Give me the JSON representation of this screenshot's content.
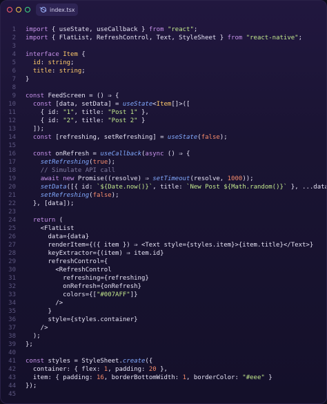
{
  "tab": {
    "label": "index.tsx"
  },
  "lines": [
    {
      "n": "1",
      "tokens": [
        [
          "kw",
          "import"
        ],
        [
          "plain",
          " { useState, useCallback } "
        ],
        [
          "kw",
          "from"
        ],
        [
          "plain",
          " "
        ],
        [
          "str",
          "\"react\""
        ],
        [
          "plain",
          ";"
        ]
      ]
    },
    {
      "n": "2",
      "tokens": [
        [
          "kw",
          "import"
        ],
        [
          "plain",
          " { FlatList, RefreshControl, Text, StyleSheet } "
        ],
        [
          "kw",
          "from"
        ],
        [
          "plain",
          " "
        ],
        [
          "str",
          "\"react-native\""
        ],
        [
          "plain",
          ";"
        ]
      ]
    },
    {
      "n": "3",
      "tokens": []
    },
    {
      "n": "4",
      "tokens": [
        [
          "kw",
          "interface"
        ],
        [
          "plain",
          " "
        ],
        [
          "type",
          "Item"
        ],
        [
          "plain",
          " {"
        ]
      ]
    },
    {
      "n": "5",
      "tokens": [
        [
          "plain",
          "  "
        ],
        [
          "prop",
          "id"
        ],
        [
          "plain",
          ": "
        ],
        [
          "type",
          "string"
        ],
        [
          "plain",
          ";"
        ]
      ]
    },
    {
      "n": "6",
      "tokens": [
        [
          "plain",
          "  "
        ],
        [
          "prop",
          "title"
        ],
        [
          "plain",
          ": "
        ],
        [
          "type",
          "string"
        ],
        [
          "plain",
          ";"
        ]
      ]
    },
    {
      "n": "7",
      "tokens": [
        [
          "plain",
          "}"
        ]
      ]
    },
    {
      "n": "8",
      "tokens": []
    },
    {
      "n": "9",
      "tokens": [
        [
          "kw",
          "const"
        ],
        [
          "plain",
          " FeedScreen = () ⇒ {"
        ]
      ]
    },
    {
      "n": "10",
      "tokens": [
        [
          "plain",
          "  "
        ],
        [
          "kw",
          "const"
        ],
        [
          "plain",
          " [data, setData] = "
        ],
        [
          "fn",
          "useState"
        ],
        [
          "plain",
          "<"
        ],
        [
          "type",
          "Item"
        ],
        [
          "plain",
          "[]>(["
        ]
      ]
    },
    {
      "n": "11",
      "tokens": [
        [
          "plain",
          "    { id: "
        ],
        [
          "str",
          "\"1\""
        ],
        [
          "plain",
          ", title: "
        ],
        [
          "str",
          "\"Post 1\""
        ],
        [
          "plain",
          " },"
        ]
      ]
    },
    {
      "n": "12",
      "tokens": [
        [
          "plain",
          "    { id: "
        ],
        [
          "str",
          "\"2\""
        ],
        [
          "plain",
          ", title: "
        ],
        [
          "str",
          "\"Post 2\""
        ],
        [
          "plain",
          " }"
        ]
      ]
    },
    {
      "n": "13",
      "tokens": [
        [
          "plain",
          "  ]);"
        ]
      ]
    },
    {
      "n": "14",
      "tokens": [
        [
          "plain",
          "  "
        ],
        [
          "kw",
          "const"
        ],
        [
          "plain",
          " [refreshing, setRefreshing] = "
        ],
        [
          "fn",
          "useState"
        ],
        [
          "plain",
          "("
        ],
        [
          "bool",
          "false"
        ],
        [
          "plain",
          ");"
        ]
      ]
    },
    {
      "n": "15",
      "tokens": []
    },
    {
      "n": "16",
      "tokens": [
        [
          "plain",
          "  "
        ],
        [
          "kw",
          "const"
        ],
        [
          "plain",
          " onRefresh = "
        ],
        [
          "fn",
          "useCallback"
        ],
        [
          "plain",
          "("
        ],
        [
          "kw",
          "async"
        ],
        [
          "plain",
          " () ⇒ {"
        ]
      ]
    },
    {
      "n": "17",
      "tokens": [
        [
          "plain",
          "    "
        ],
        [
          "fn",
          "setRefreshing"
        ],
        [
          "plain",
          "("
        ],
        [
          "bool",
          "true"
        ],
        [
          "plain",
          ");"
        ]
      ]
    },
    {
      "n": "18",
      "tokens": [
        [
          "plain",
          "    "
        ],
        [
          "cm",
          "// Simulate API call"
        ]
      ]
    },
    {
      "n": "19",
      "tokens": [
        [
          "plain",
          "    "
        ],
        [
          "kw",
          "await"
        ],
        [
          "plain",
          " "
        ],
        [
          "kw",
          "new"
        ],
        [
          "plain",
          " Promise((resolve) ⇒ "
        ],
        [
          "fn",
          "setTimeout"
        ],
        [
          "plain",
          "(resolve, "
        ],
        [
          "num",
          "1000"
        ],
        [
          "plain",
          "));"
        ]
      ]
    },
    {
      "n": "20",
      "tokens": [
        [
          "plain",
          "    "
        ],
        [
          "fn",
          "setData"
        ],
        [
          "plain",
          "([{ id: "
        ],
        [
          "str",
          "`${Date.now()}`"
        ],
        [
          "plain",
          ", title: "
        ],
        [
          "str",
          "`New Post ${Math.random()}`"
        ],
        [
          "plain",
          " }, ...data]);"
        ]
      ]
    },
    {
      "n": "21",
      "tokens": [
        [
          "plain",
          "    "
        ],
        [
          "fn",
          "setRefreshing"
        ],
        [
          "plain",
          "("
        ],
        [
          "bool",
          "false"
        ],
        [
          "plain",
          ");"
        ]
      ]
    },
    {
      "n": "22",
      "tokens": [
        [
          "plain",
          "  }, [data]);"
        ]
      ]
    },
    {
      "n": "23",
      "tokens": []
    },
    {
      "n": "24",
      "tokens": [
        [
          "plain",
          "  "
        ],
        [
          "kw",
          "return"
        ],
        [
          "plain",
          " ("
        ]
      ]
    },
    {
      "n": "25",
      "tokens": [
        [
          "plain",
          "    <"
        ],
        [
          "tag",
          "FlatList"
        ]
      ]
    },
    {
      "n": "26",
      "tokens": [
        [
          "plain",
          "      data={data}"
        ]
      ]
    },
    {
      "n": "27",
      "tokens": [
        [
          "plain",
          "      renderItem={({ item }) ⇒ <"
        ],
        [
          "tag",
          "Text"
        ],
        [
          "plain",
          " style={styles.item}>{item.title}</"
        ],
        [
          "tag",
          "Text"
        ],
        [
          "plain",
          ">}"
        ]
      ]
    },
    {
      "n": "28",
      "tokens": [
        [
          "plain",
          "      keyExtractor={(item) ⇒ item.id}"
        ]
      ]
    },
    {
      "n": "29",
      "tokens": [
        [
          "plain",
          "      refreshControl={"
        ]
      ]
    },
    {
      "n": "30",
      "tokens": [
        [
          "plain",
          "        <"
        ],
        [
          "tag",
          "RefreshControl"
        ]
      ]
    },
    {
      "n": "31",
      "tokens": [
        [
          "plain",
          "          refreshing={refreshing}"
        ]
      ]
    },
    {
      "n": "32",
      "tokens": [
        [
          "plain",
          "          onRefresh={onRefresh}"
        ]
      ]
    },
    {
      "n": "33",
      "tokens": [
        [
          "plain",
          "          colors={["
        ],
        [
          "str",
          "\"#007AFF\""
        ],
        [
          "plain",
          "]}"
        ]
      ]
    },
    {
      "n": "34",
      "tokens": [
        [
          "plain",
          "        />"
        ]
      ]
    },
    {
      "n": "35",
      "tokens": [
        [
          "plain",
          "      }"
        ]
      ]
    },
    {
      "n": "36",
      "tokens": [
        [
          "plain",
          "      style={styles.container}"
        ]
      ]
    },
    {
      "n": "37",
      "tokens": [
        [
          "plain",
          "    />"
        ]
      ]
    },
    {
      "n": "38",
      "tokens": [
        [
          "plain",
          "  );"
        ]
      ]
    },
    {
      "n": "39",
      "tokens": [
        [
          "plain",
          "};"
        ]
      ]
    },
    {
      "n": "40",
      "tokens": []
    },
    {
      "n": "41",
      "tokens": [
        [
          "kw",
          "const"
        ],
        [
          "plain",
          " styles = StyleSheet."
        ],
        [
          "fn",
          "create"
        ],
        [
          "plain",
          "({"
        ]
      ]
    },
    {
      "n": "42",
      "tokens": [
        [
          "plain",
          "  container: { flex: "
        ],
        [
          "num",
          "1"
        ],
        [
          "plain",
          ", padding: "
        ],
        [
          "num",
          "20"
        ],
        [
          "plain",
          " },"
        ]
      ]
    },
    {
      "n": "43",
      "tokens": [
        [
          "plain",
          "  item: { padding: "
        ],
        [
          "num",
          "16"
        ],
        [
          "plain",
          ", borderBottomWidth: "
        ],
        [
          "num",
          "1"
        ],
        [
          "plain",
          ", borderColor: "
        ],
        [
          "str",
          "\"#eee\""
        ],
        [
          "plain",
          " }"
        ]
      ]
    },
    {
      "n": "44",
      "tokens": [
        [
          "plain",
          "});"
        ]
      ]
    },
    {
      "n": "45",
      "tokens": []
    }
  ]
}
